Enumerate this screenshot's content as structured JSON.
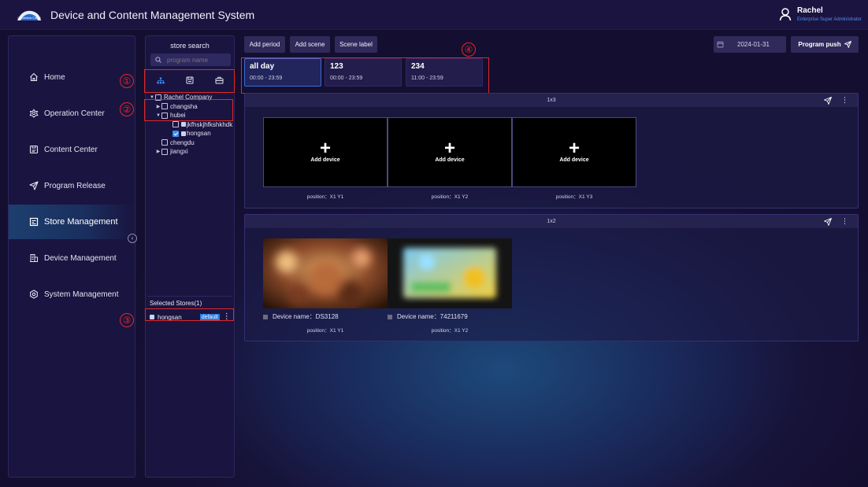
{
  "app": {
    "title": "Device and Content Management System",
    "logo_text": "Goodview Cloud"
  },
  "user": {
    "name": "Rachel",
    "role": "Enterprise Super Administrator"
  },
  "sidebar": {
    "items": [
      {
        "label": "Home",
        "icon": "home-icon"
      },
      {
        "label": "Operation Center",
        "icon": "operation-icon"
      },
      {
        "label": "Content Center",
        "icon": "content-icon"
      },
      {
        "label": "Program Release",
        "icon": "send-icon"
      },
      {
        "label": "Store Management",
        "icon": "store-icon",
        "active": true
      },
      {
        "label": "Device Management",
        "icon": "device-icon"
      },
      {
        "label": "System Management",
        "icon": "settings-icon"
      }
    ],
    "collapse_glyph": "‹"
  },
  "store_panel": {
    "title": "store search",
    "search_placeholder": "program name",
    "tree": {
      "company": "Rachel Company",
      "changsha": "changsha",
      "hubei": "hubei",
      "store1": "jkfhskjhfkshkhdk",
      "store2": "hongsan",
      "chengdu": "chengdu",
      "jiangxi": "jiangxi"
    },
    "selected_title": "Selected Stores(1)",
    "selected_store": "hongsan",
    "selected_badge": "default",
    "more_glyph": "⋮"
  },
  "annotations": [
    "①",
    "②",
    "③",
    "④"
  ],
  "toolbar": {
    "add_period": "Add period",
    "add_scene": "Add scene",
    "scene_label": "Scene label",
    "date": "2024-01-31",
    "program_push": "Program push"
  },
  "periods": [
    {
      "name": "all day",
      "time": "00:00 - 23:59",
      "active": true
    },
    {
      "name": "123",
      "time": "00:00 - 23:59"
    },
    {
      "name": "234",
      "time": "11:00 - 23:59"
    }
  ],
  "scenes": [
    {
      "layout": "1x3",
      "slots": [
        {
          "label": "Add device",
          "plus": "+",
          "position": "position：X1 Y1"
        },
        {
          "label": "Add device",
          "plus": "+",
          "position": "position：X1 Y2"
        },
        {
          "label": "Add device",
          "plus": "+",
          "position": "position：X1 Y3"
        }
      ]
    },
    {
      "layout": "1x2",
      "devices": [
        {
          "name": "Device name：DS3128",
          "position": "position：X1 Y1"
        },
        {
          "name": "Device name：74211679",
          "position": "position：X1 Y2"
        }
      ]
    }
  ],
  "more_glyph": "⋮",
  "colors": {
    "accent": "#3d8bf0",
    "annotation": "#e02828",
    "panel": "#1a1440"
  }
}
